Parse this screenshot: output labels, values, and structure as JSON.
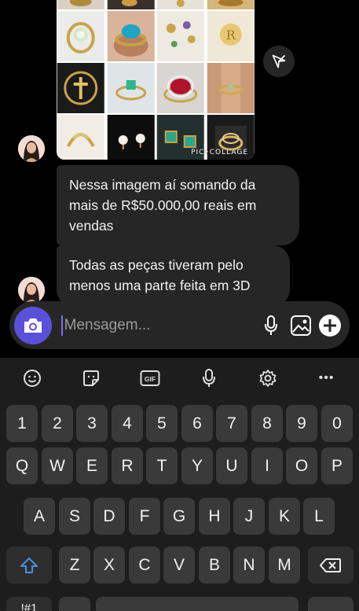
{
  "collage": {
    "watermark": "PIC•COLLAGE"
  },
  "messages": [
    {
      "text": "Nessa imagem aí somando da mais de R$50.000,00 reais em vendas"
    },
    {
      "text": "Todas as peças tiveram pelo menos uma parte feita em 3D"
    }
  ],
  "composer": {
    "placeholder": "Mensagem...",
    "value": ""
  },
  "keyboard": {
    "toolbar": [
      "emoji-icon",
      "sticker-icon",
      "gif-icon",
      "mic-icon",
      "settings-icon",
      "more-icon"
    ],
    "gif_label": "GIF",
    "more_label": "•••",
    "rows": {
      "numbers": [
        "1",
        "2",
        "3",
        "4",
        "5",
        "6",
        "7",
        "8",
        "9",
        "0"
      ],
      "top": [
        "Q",
        "W",
        "E",
        "R",
        "T",
        "Y",
        "U",
        "I",
        "O",
        "P"
      ],
      "middle": [
        "A",
        "S",
        "D",
        "F",
        "G",
        "H",
        "J",
        "K",
        "L"
      ],
      "bottom": [
        "Z",
        "X",
        "C",
        "V",
        "B",
        "N",
        "M"
      ]
    },
    "partial_bottom_left": "!#1"
  },
  "colors": {
    "background": "#000000",
    "bubble": "#262626",
    "accent": "#5b51d8",
    "keyboard": "#1d1d1d",
    "key": "#3a3a3a",
    "shift": "#4a90e2"
  }
}
